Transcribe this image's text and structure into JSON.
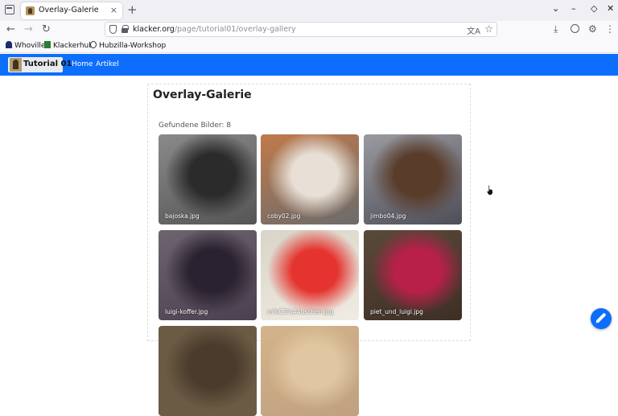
{
  "browser": {
    "tab_title": "Overlay-Galerie",
    "tab_close": "×",
    "new_tab": "+",
    "window_controls": [
      "⌄",
      "–",
      "◇",
      "✕"
    ],
    "nav_buttons": [
      "←",
      "→",
      "↻"
    ],
    "url_host": "klacker.org",
    "url_path": "/page/tutorial01/overlay-gallery",
    "translate_glyph": "文A",
    "bookmark_star": "☆",
    "toolbar_icons": [
      "⤓",
      "⚙",
      "⋮"
    ],
    "bookmarks": [
      {
        "label": "Whoville",
        "icon": "whoville-icon",
        "color": "#1c2b6b"
      },
      {
        "label": "Klackerhub",
        "icon": "klackerhub-icon",
        "color": "#2e7d32"
      },
      {
        "label": "Hubzilla-Workshop",
        "icon": "hubzilla-icon",
        "color": "#333333"
      }
    ]
  },
  "site": {
    "brand": "Tutorial 01",
    "nav": [
      "Home",
      "Artikel"
    ],
    "accent": "#0d6efd"
  },
  "page": {
    "title": "Overlay-Galerie",
    "count_text": "Gefundene Bilder: 8",
    "images": [
      {
        "caption": "bajoska.jpg",
        "colors": [
          "#8a8a8a",
          "#2b2b2b",
          "#555"
        ]
      },
      {
        "caption": "coby02.jpg",
        "colors": [
          "#c07a4b",
          "#e8e0d6",
          "#6b6b6b"
        ]
      },
      {
        "caption": "jimbo04.jpg",
        "colors": [
          "#9a9aa0",
          "#5a3c2a",
          "#4e4e58"
        ]
      },
      {
        "caption": "luigi-koffer.jpg",
        "colors": [
          "#6e6470",
          "#2a2230",
          "#4b4050"
        ]
      },
      {
        "caption": "m%C3%A4uschen.jpg",
        "colors": [
          "#d9d4c8",
          "#e5342f",
          "#f0ece3"
        ]
      },
      {
        "caption": "piet_und_luigi.jpg",
        "colors": [
          "#5a4a3a",
          "#b8204a",
          "#3e2f25"
        ]
      },
      {
        "caption": "",
        "colors": [
          "#6b5b45",
          "#4a3b2c",
          "#6b5b45"
        ]
      },
      {
        "caption": "",
        "colors": [
          "#d4b48a",
          "#e0c7a2",
          "#bfa080"
        ]
      }
    ]
  }
}
